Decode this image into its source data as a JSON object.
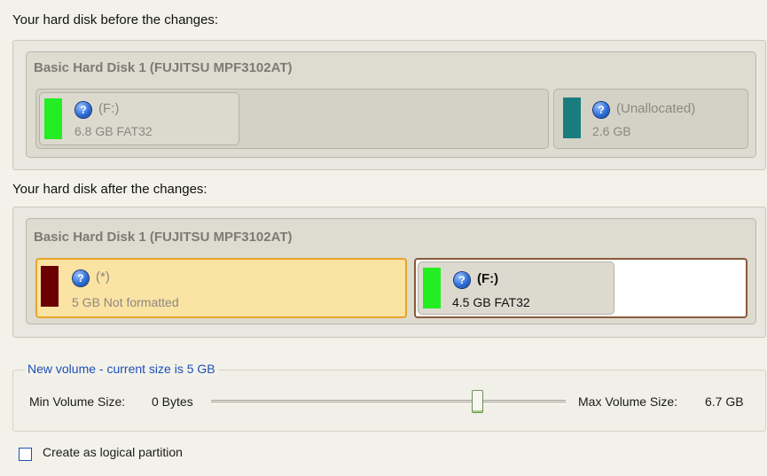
{
  "before": {
    "label": "Your hard disk before the changes:",
    "disk_title": "Basic Hard Disk 1 (FUJITSU MPF3102AT)",
    "partitions": [
      {
        "name": "(F:)",
        "info": "6.8 GB FAT32",
        "color": "#22ee22"
      },
      {
        "name": "(Unallocated)",
        "info": "2.6 GB",
        "color": "#1a7d7d"
      }
    ]
  },
  "after": {
    "label": "Your hard disk after the changes:",
    "disk_title": "Basic Hard Disk 1 (FUJITSU MPF3102AT)",
    "partitions": [
      {
        "name": "(*)",
        "info": "5 GB Not formatted",
        "color": "#6b0000"
      },
      {
        "name": "(F:)",
        "info": "4.5 GB FAT32",
        "color": "#22ee22"
      }
    ]
  },
  "new_volume": {
    "legend": "New volume - current size is 5 GB",
    "min_label": "Min Volume Size:",
    "min_value": "0 Bytes",
    "max_label": "Max Volume Size:",
    "max_value": "6.7 GB",
    "slider_fraction": 0.75
  },
  "logical_partition": {
    "label": "Create as logical partition",
    "checked": false
  },
  "colors": {
    "selected_partition_bg": "#fbe3a4",
    "selected_partition_border": "#e6a52a",
    "accent_text": "#1d4fb8"
  },
  "icons": {
    "partition_help": "help-question-icon"
  }
}
